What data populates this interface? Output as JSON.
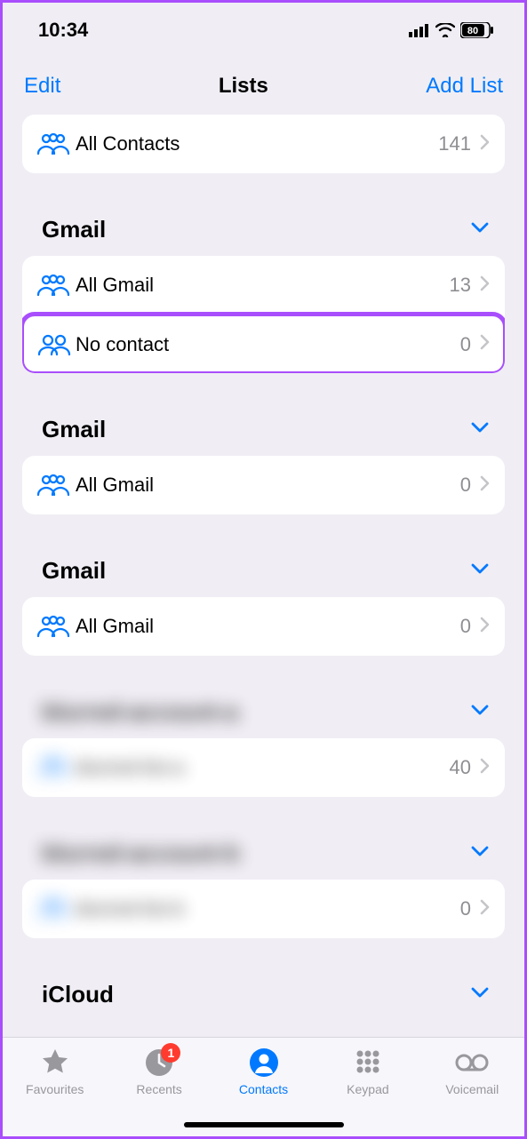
{
  "status": {
    "time": "10:34",
    "battery": "80"
  },
  "nav": {
    "left": "Edit",
    "title": "Lists",
    "right": "Add List"
  },
  "top_row": {
    "label": "All Contacts",
    "count": "141"
  },
  "sections": [
    {
      "title": "Gmail",
      "rows": [
        {
          "label": "All Gmail",
          "count": "13",
          "icon": "three",
          "highlight": false
        },
        {
          "label": "No contact",
          "count": "0",
          "icon": "two",
          "highlight": true
        }
      ]
    },
    {
      "title": "Gmail",
      "rows": [
        {
          "label": "All Gmail",
          "count": "0",
          "icon": "three"
        }
      ]
    },
    {
      "title": "Gmail",
      "rows": [
        {
          "label": "All Gmail",
          "count": "0",
          "icon": "three"
        }
      ]
    },
    {
      "title": "blurred-account-a",
      "blurred": true,
      "rows": [
        {
          "label": "blurred-list-a",
          "count": "40",
          "icon": "three"
        }
      ]
    },
    {
      "title": "blurred-account-b",
      "blurred": true,
      "rows": [
        {
          "label": "blurred-list-b",
          "count": "0",
          "icon": "three"
        }
      ]
    },
    {
      "title": "iCloud",
      "rows": []
    }
  ],
  "tabs": {
    "favourites": "Favourites",
    "recents": "Recents",
    "recents_badge": "1",
    "contacts": "Contacts",
    "keypad": "Keypad",
    "voicemail": "Voicemail"
  }
}
